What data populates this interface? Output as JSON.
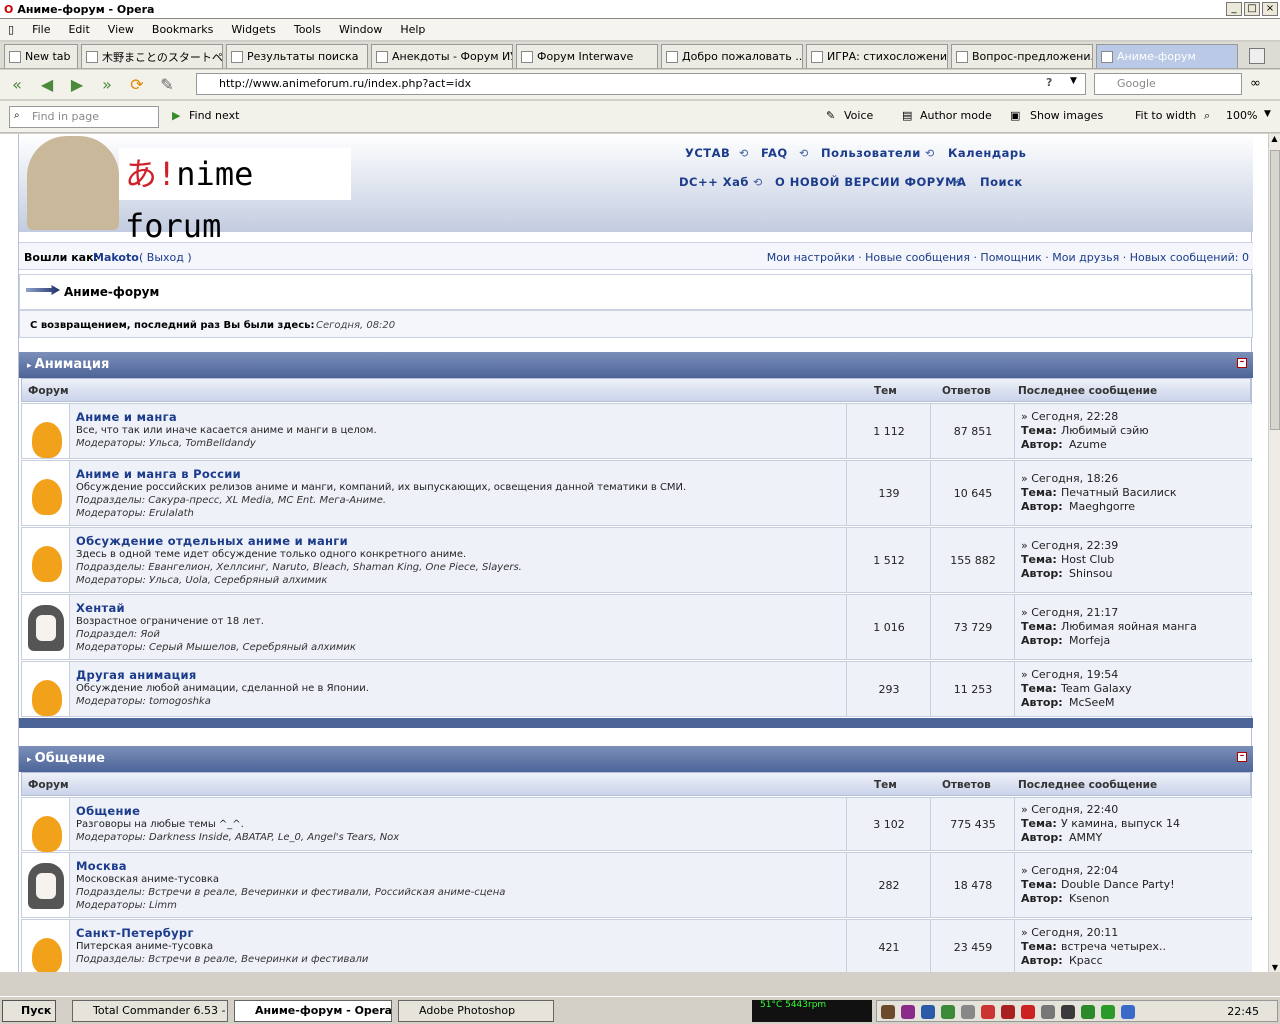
{
  "window": {
    "title": "Аниме-форум - Opera"
  },
  "menu": [
    "File",
    "Edit",
    "View",
    "Bookmarks",
    "Widgets",
    "Tools",
    "Window",
    "Help"
  ],
  "tabs": [
    {
      "label": "New tab"
    },
    {
      "label": "木野まことのスタートペ..."
    },
    {
      "label": "Результаты поиска"
    },
    {
      "label": "Анекдоты - Форум ИУ8"
    },
    {
      "label": "Форум Interwave"
    },
    {
      "label": "Добро пожаловать ..."
    },
    {
      "label": "ИГРА: стихосложени..."
    },
    {
      "label": "Вопрос-предложени..."
    },
    {
      "label": "Аниме-форум"
    }
  ],
  "address": {
    "url": "http://www.animeforum.ru/index.php?act=idx",
    "search_placeholder": "Google"
  },
  "findbar": {
    "placeholder": "Find in page",
    "find_next": "Find next",
    "voice": "Voice",
    "author_mode": "Author mode",
    "show_images": "Show images",
    "fit_to_width": "Fit to width",
    "zoom": "100%"
  },
  "banner": {
    "logo_a": "あ!",
    "logo_rest": "nime forum",
    "links_row1": [
      "УСТАВ",
      "FAQ",
      "Пользователи",
      "Календарь"
    ],
    "links_row2": [
      "DC++ Хаб",
      "О НОВОЙ ВЕРСИИ ФОРУМА",
      "Поиск"
    ]
  },
  "userbar": {
    "logged_as": "Вошли как:",
    "user": "Makoto",
    "logout": "( Выход )",
    "links": "Мои настройки · Новые сообщения · Помощник · Мои друзья · Новых сообщений: 0"
  },
  "breadcrumb": "Аниме-форум",
  "welcome": {
    "text": "С возвращением, последний раз Вы были здесь:",
    "time": "Сегодня, 08:20"
  },
  "columns": {
    "forum": "Форум",
    "topics": "Тем",
    "replies": "Ответов",
    "last": "Последнее сообщение"
  },
  "categories": [
    {
      "title": "Анимация",
      "forums": [
        {
          "title": "Аниме и манга",
          "desc": "Все, что так или иначе касается аниме и манги в целом.",
          "meta1": "Модераторы: Ульса, TomBelldandy",
          "meta2": "",
          "topics": "1 112",
          "replies": "87 851",
          "last_date": "» Сегодня, 22:28",
          "last_topic": "Любимый сэйю",
          "last_author": "Azume",
          "icon": "cat"
        },
        {
          "title": "Аниме и манга в России",
          "desc": "Обсуждение российских релизов аниме и манги, компаний, их выпускающих, освещения данной тематики в СМИ.",
          "meta1": "Подразделы: Сакура-пресс, XL Media, MC Ent. Мега-Аниме.",
          "meta2": "Модераторы: Erulalath",
          "topics": "139",
          "replies": "10 645",
          "last_date": "» Сегодня, 18:26",
          "last_topic": "Печатный Василиск",
          "last_author": "Maeghgorre",
          "icon": "cat"
        },
        {
          "title": "Обсуждение отдельных аниме и манги",
          "desc": "Здесь в одной теме идет обсуждение только одного конкретного аниме.",
          "meta1": "Подразделы: Евангелион, Хеллсинг, Naruto, Bleach, Shaman King, One Piece, Slayers.",
          "meta2": "Модераторы: Ульса, Uola, Серебряный алхимик",
          "topics": "1 512",
          "replies": "155 882",
          "last_date": "» Сегодня, 22:39",
          "last_topic": "Host Club",
          "last_author": "Shinsou",
          "icon": "cat"
        },
        {
          "title": "Хентай",
          "desc": "Возрастное ограничение от 18 лет.",
          "meta1": "Подраздел: Яой",
          "meta2": "Модераторы: Серый Мышелов, Серебряный алхимик",
          "topics": "1 016",
          "replies": "73 729",
          "last_date": "» Сегодня, 21:17",
          "last_topic": "Любимая яойная манга",
          "last_author": "Morfeja",
          "icon": "girl"
        },
        {
          "title": "Другая анимация",
          "desc": "Обсуждение любой анимации, сделанной не в Японии.",
          "meta1": "Модераторы: tomogoshka",
          "meta2": "",
          "topics": "293",
          "replies": "11 253",
          "last_date": "» Сегодня, 19:54",
          "last_topic": "Team Galaxy",
          "last_author": "McSeeM",
          "icon": "cat"
        }
      ]
    },
    {
      "title": "Общение",
      "forums": [
        {
          "title": "Общение",
          "desc": "Разговоры на любые темы ^_^.",
          "meta1": "Модераторы: Darkness Inside, ABATAP, Le_0, Angel's Tears, Nox",
          "meta2": "",
          "topics": "3 102",
          "replies": "775 435",
          "last_date": "» Сегодня, 22:40",
          "last_topic": "У камина, выпуск 14",
          "last_author": "AMMY",
          "icon": "cat"
        },
        {
          "title": "Москва",
          "desc": "Московская аниме-тусовка",
          "meta1": "Подразделы: Встречи в реале, Вечеринки и фестивали, Российская аниме-сцена",
          "meta2": "Модераторы: Limm",
          "topics": "282",
          "replies": "18 478",
          "last_date": "» Сегодня, 22:04",
          "last_topic": "Double Dance Party!",
          "last_author": "Ksenon",
          "icon": "girl"
        },
        {
          "title": "Санкт-Петербург",
          "desc": "Питерская аниме-тусовка",
          "meta1": "Подразделы: Встречи в реале, Вечеринки и фестивали",
          "meta2": "",
          "topics": "421",
          "replies": "23 459",
          "last_date": "» Сегодня, 20:11",
          "last_topic": "встреча четырех..",
          "last_author": "Красс",
          "icon": "cat"
        }
      ]
    }
  ],
  "labels": {
    "topic": "Тема:",
    "author": "Автор:"
  },
  "taskbar": {
    "start": "Пуск",
    "tasks": [
      "Total Commander 6.53 - ...",
      "Аниме-форум - Opera",
      "Adobe Photoshop"
    ],
    "clock": "22:45",
    "graph": "51°C 5443rpm"
  }
}
